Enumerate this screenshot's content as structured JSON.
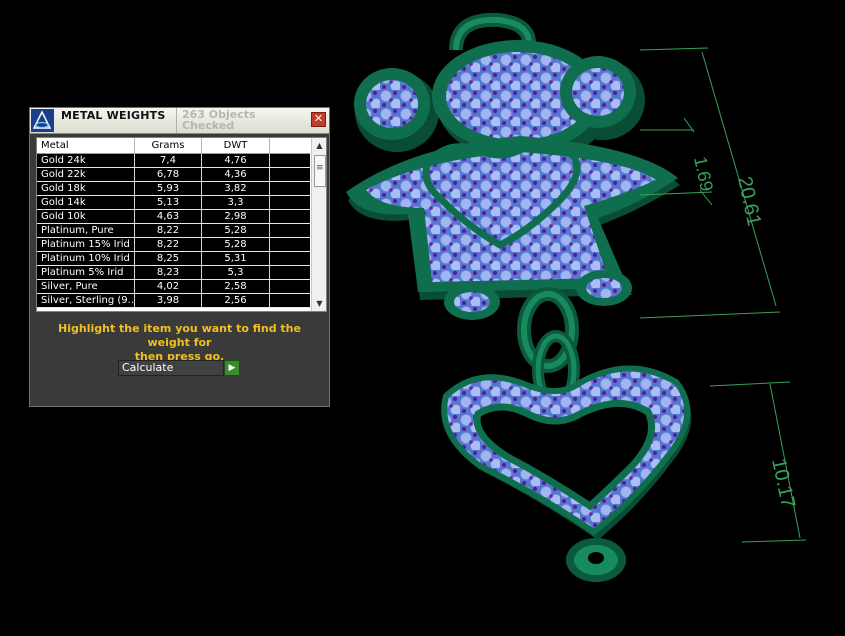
{
  "panel": {
    "title": "METAL WEIGHTS",
    "status_line1": "263 Objects",
    "status_line2": "Checked",
    "close_glyph": "✕",
    "columns": [
      "Metal",
      "Grams",
      "DWT"
    ],
    "rows": [
      {
        "metal": "Gold 24k",
        "grams": "7,4",
        "dwt": "4,76"
      },
      {
        "metal": "Gold 22k",
        "grams": "6,78",
        "dwt": "4,36"
      },
      {
        "metal": "Gold 18k",
        "grams": "5,93",
        "dwt": "3,82"
      },
      {
        "metal": "Gold 14k",
        "grams": "5,13",
        "dwt": "3,3"
      },
      {
        "metal": "Gold 10k",
        "grams": "4,63",
        "dwt": "2,98"
      },
      {
        "metal": "Platinum, Pure",
        "grams": "8,22",
        "dwt": "5,28"
      },
      {
        "metal": "Platinum 15% Irid",
        "grams": "8,22",
        "dwt": "5,28"
      },
      {
        "metal": "Platinum 10% Irid",
        "grams": "8,25",
        "dwt": "5,31"
      },
      {
        "metal": "Platinum 5% Irid",
        "grams": "8,23",
        "dwt": "5,3"
      },
      {
        "metal": "Silver, Pure",
        "grams": "4,02",
        "dwt": "2,58"
      },
      {
        "metal": "Silver, Sterling (9...",
        "grams": "3,98",
        "dwt": "2,56"
      }
    ],
    "instruction_line1": "Highlight the item you want to find the weight for",
    "instruction_line2": "then press go.",
    "calculate_label": "Calculate",
    "go_glyph": "▶"
  },
  "dimensions": {
    "top_small": "1.69",
    "overall": "20.61",
    "heart": "10.17"
  },
  "colors": {
    "metal_green": "#0f6e4e",
    "gem_blue": "#8fa8ea",
    "prong_purple": "#5a1a90",
    "dimension_line": "#3aa05a",
    "instruction_text": "#f0c020"
  },
  "icons": [
    "app-icon",
    "close-icon",
    "scroll-up-icon",
    "scroll-down-icon",
    "go-arrow-icon"
  ]
}
